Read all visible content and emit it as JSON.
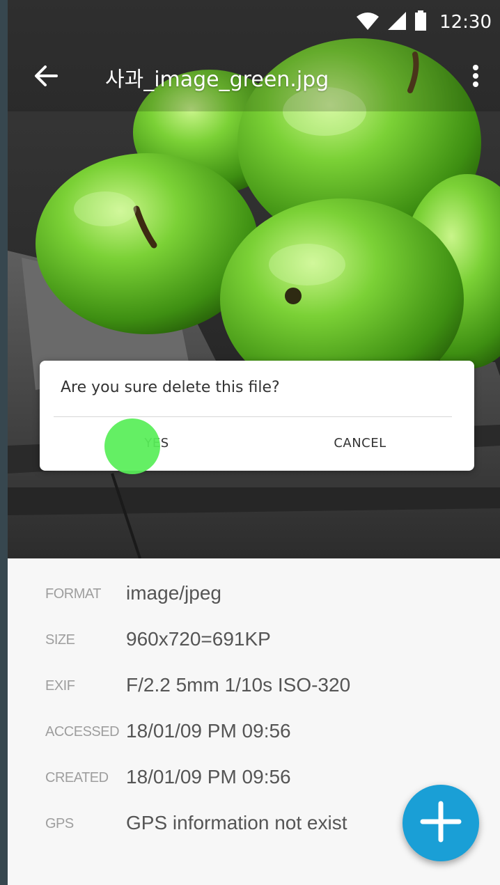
{
  "status_bar": {
    "time": "12:30",
    "icons": [
      "wifi-icon",
      "cell-signal-icon",
      "battery-icon"
    ]
  },
  "toolbar": {
    "title": "사과_image_green.jpg",
    "back_icon": "arrow-back-icon",
    "more_icon": "more-vert-icon"
  },
  "dialog": {
    "message": "Are you sure delete this file?",
    "yes_label": "YES",
    "cancel_label": "CANCEL"
  },
  "details": [
    {
      "label": "FORMAT",
      "value": "image/jpeg"
    },
    {
      "label": "SIZE",
      "value": "960x720=691KP"
    },
    {
      "label": "EXIF",
      "value": "F/2.2 5mm 1/10s ISO-320"
    },
    {
      "label": "ACCESSED",
      "value": "18/01/09 PM 09:56"
    },
    {
      "label": "CREATED",
      "value": "18/01/09 PM 09:56"
    },
    {
      "label": "GPS",
      "value": "GPS information not exist"
    }
  ],
  "fab": {
    "icon": "plus-icon"
  },
  "colors": {
    "fab": "#1a9fd6",
    "touch_indicator": "#58ee58",
    "apple_green": "#6cc62c"
  }
}
